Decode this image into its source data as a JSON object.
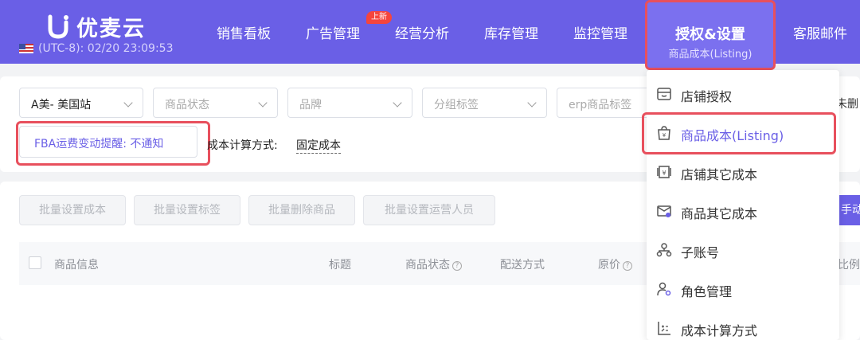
{
  "header": {
    "logo_text": "优麦云",
    "timezone": "(UTC-8): 02/20 23:09:53",
    "nav": [
      {
        "label": "销售看板"
      },
      {
        "label": "广告管理",
        "badge": "上新"
      },
      {
        "label": "经营分析"
      },
      {
        "label": "库存管理"
      },
      {
        "label": "监控管理"
      }
    ],
    "active_nav": {
      "label": "授权&设置",
      "sub": "商品成本(Listing)"
    },
    "last_nav": "客服邮件"
  },
  "filters": {
    "site": "A美- 美国站",
    "status_placeholder": "商品状态",
    "brand_placeholder": "品牌",
    "group_placeholder": "分组标签",
    "erp_placeholder": "erp商品标签",
    "truncated_label": "未删",
    "fba_reminder": "FBA运费变动提醒: 不通知",
    "cost_method_label": "成本计算方式:",
    "cost_method_value": "固定成本"
  },
  "actions": [
    "批量设置成本",
    "批量设置标签",
    "批量删除商品",
    "批量设置运营人员"
  ],
  "manual_button": "手动",
  "table": {
    "columns": [
      "商品信息",
      "标题",
      "商品状态",
      "配送方式",
      "原价",
      "比例"
    ]
  },
  "dropdown": {
    "items": [
      {
        "label": "店铺授权",
        "icon": "store-auth-icon"
      },
      {
        "label": "商品成本(Listing)",
        "icon": "product-cost-icon",
        "active": true
      },
      {
        "label": "店铺其它成本",
        "icon": "store-other-cost-icon"
      },
      {
        "label": "商品其它成本",
        "icon": "product-other-cost-icon"
      },
      {
        "label": "子账号",
        "icon": "sub-account-icon"
      },
      {
        "label": "角色管理",
        "icon": "role-management-icon"
      },
      {
        "label": "成本计算方式",
        "icon": "cost-method-icon"
      }
    ]
  },
  "colors": {
    "brand": "#6a5fe6",
    "highlight": "#e8505d",
    "badge": "#f5453d"
  }
}
